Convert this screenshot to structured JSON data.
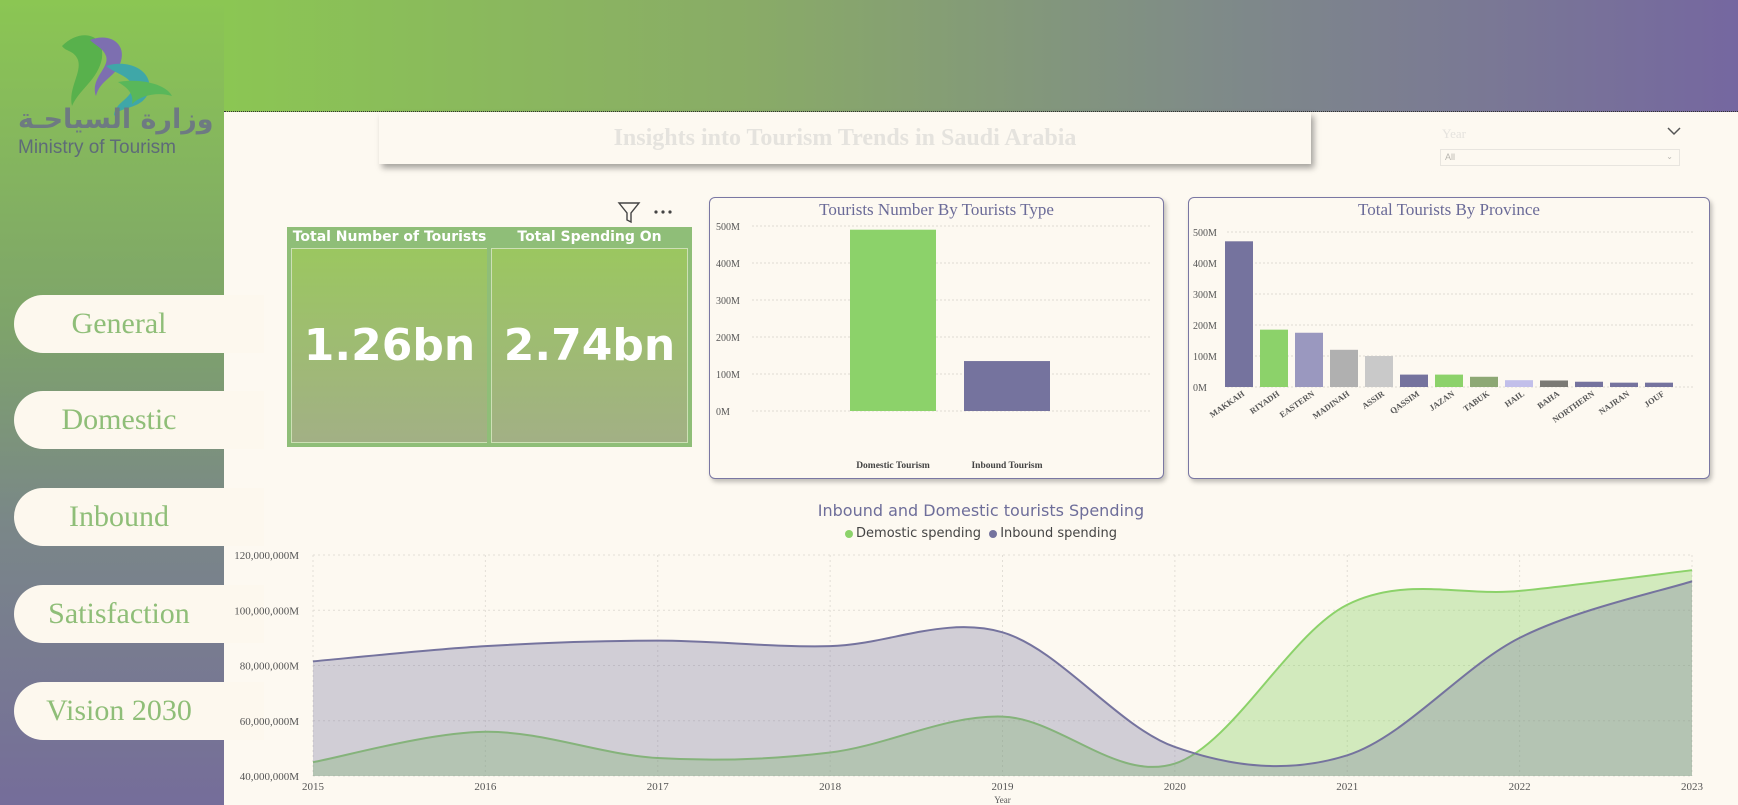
{
  "brand": {
    "logo_text_ar": "وزارة السياحـة",
    "logo_text_en": "Ministry of Tourism"
  },
  "nav": {
    "items": [
      {
        "label": "General"
      },
      {
        "label": "Domestic"
      },
      {
        "label": "Inbound"
      },
      {
        "label": "Satisfaction"
      },
      {
        "label": "Vision 2030"
      }
    ]
  },
  "header": {
    "title": "Insights into Tourism Trends in Saudi Arabia"
  },
  "slicer": {
    "label": "Year",
    "value": "All"
  },
  "cards": [
    {
      "title": "Total Number of Tourists",
      "value": "1.26bn"
    },
    {
      "title": "Total Spending On Tourism",
      "value": "2.74bn"
    }
  ],
  "colors": {
    "green": "#8cd26a",
    "purple": "#75739e",
    "label": "#6b6b98"
  },
  "chart_data": [
    {
      "type": "bar",
      "title": "Tourists Number By Tourists Type",
      "categories": [
        "Domestic Tourism",
        "Inbound Tourism"
      ],
      "values": [
        490,
        135
      ],
      "unit": "M",
      "yticks": [
        "0M",
        "100M",
        "200M",
        "300M",
        "400M",
        "500M"
      ],
      "ylim": [
        0,
        500
      ]
    },
    {
      "type": "bar",
      "title": "Total Tourists By Province",
      "categories": [
        "MAKKAH",
        "RIYADH",
        "EASTERN",
        "MADINAH",
        "ASSIR",
        "QASSIM",
        "JAZAN",
        "TABUK",
        "HAIL",
        "BAHA",
        "NORTHERN",
        "NAJRAN",
        "JOUF"
      ],
      "values": [
        470,
        185,
        175,
        120,
        100,
        40,
        40,
        33,
        22,
        21,
        17,
        14,
        14
      ],
      "unit": "M",
      "yticks": [
        "0M",
        "100M",
        "200M",
        "300M",
        "400M",
        "500M"
      ],
      "ylim": [
        0,
        500
      ]
    },
    {
      "type": "area",
      "title": "Inbound and Domestic tourists Spending",
      "xlabel": "Year",
      "x": [
        2015,
        2016,
        2017,
        2018,
        2019,
        2020,
        2021,
        2022,
        2023
      ],
      "series": [
        {
          "name": "Demostic spending",
          "values": [
            45000000,
            56000000,
            46500000,
            48500000,
            61500000,
            44500000,
            102000000,
            107000000,
            114500000
          ]
        },
        {
          "name": "Inbound spending",
          "values": [
            81500000,
            87000000,
            89000000,
            87000000,
            92000000,
            50500000,
            47500000,
            90000000,
            110500000
          ]
        }
      ],
      "yticks": [
        "40,000,000M",
        "60,000,000M",
        "80,000,000M",
        "100,000,000M",
        "120,000,000M"
      ],
      "ylim": [
        40000000,
        120000000
      ]
    }
  ]
}
